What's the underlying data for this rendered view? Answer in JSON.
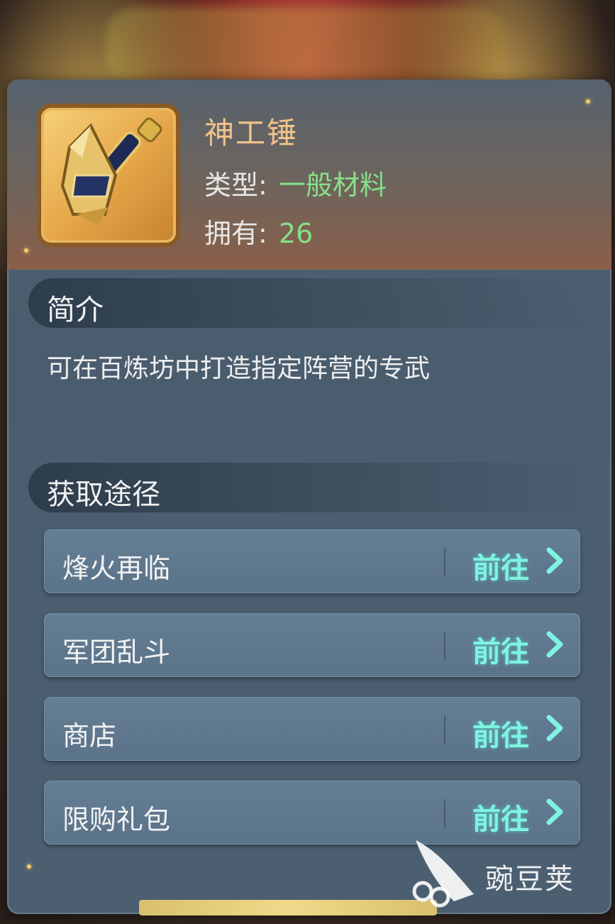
{
  "item": {
    "name": "神工锤",
    "type_label": "类型:",
    "type_value": "一般材料",
    "own_label": "拥有:",
    "own_value": "26",
    "icon": "hammer-icon"
  },
  "intro": {
    "title": "简介",
    "text": "可在百炼坊中打造指定阵营的专武"
  },
  "sources": {
    "title": "获取途径",
    "routes": [
      {
        "name": "烽火再临",
        "action": "前往"
      },
      {
        "name": "军团乱斗",
        "action": "前往"
      },
      {
        "name": "商店",
        "action": "前往"
      },
      {
        "name": "限购礼包",
        "action": "前往"
      }
    ]
  },
  "watermark": {
    "text": "豌豆荚"
  },
  "colors": {
    "accent_green": "#86e08a",
    "go_cyan": "#7ff3e2",
    "name_gold": "#f1c28a"
  }
}
